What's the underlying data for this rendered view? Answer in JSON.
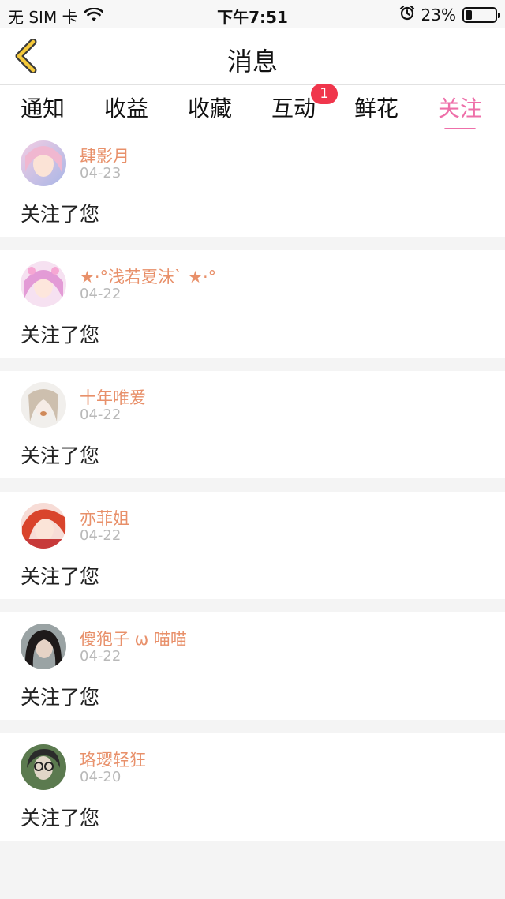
{
  "status_bar": {
    "carrier": "无 SIM 卡",
    "time": "下午7:51",
    "battery": "23%",
    "battery_level": 0.23
  },
  "nav": {
    "title": "消息"
  },
  "tabs": [
    {
      "label": "通知",
      "active": false
    },
    {
      "label": "收益",
      "active": false
    },
    {
      "label": "收藏",
      "active": false
    },
    {
      "label": "互动",
      "active": false,
      "badge": "1"
    },
    {
      "label": "鲜花",
      "active": false
    },
    {
      "label": "关注",
      "active": true
    }
  ],
  "colors": {
    "accent": "#ee6fa9",
    "username": "#e8906a",
    "badge": "#f0364c"
  },
  "messages": [
    {
      "name": "肆影月",
      "date": "04-23",
      "text": "关注了您"
    },
    {
      "name": "★·°浅若夏沫ˋ  ★·°",
      "date": "04-22",
      "text": "关注了您"
    },
    {
      "name": "十年唯爱",
      "date": "04-22",
      "text": "关注了您"
    },
    {
      "name": "亦菲姐",
      "date": "04-22",
      "text": "关注了您"
    },
    {
      "name": "傻狍子 ω 喵喵",
      "date": "04-22",
      "text": "关注了您"
    },
    {
      "name": "珞璎轻狂",
      "date": "04-20",
      "text": "关注了您"
    }
  ]
}
